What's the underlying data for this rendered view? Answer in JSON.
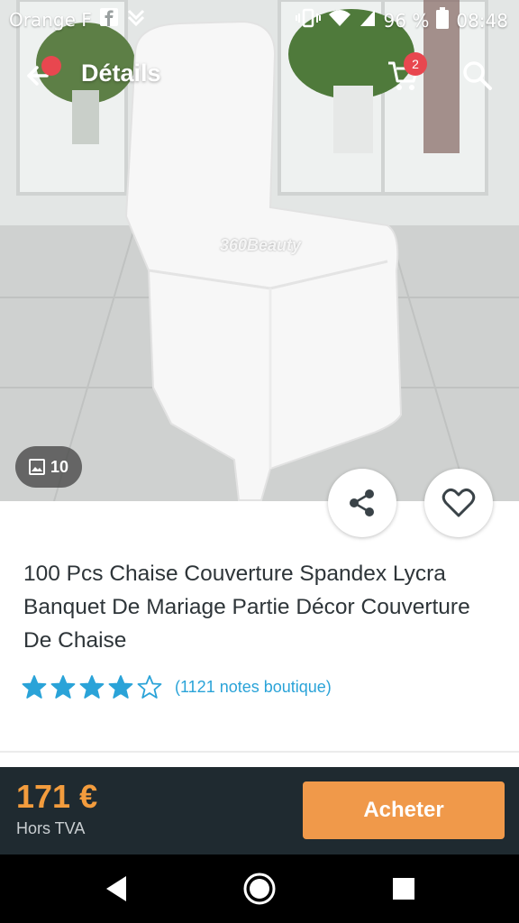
{
  "status_bar": {
    "carrier": "Orange F",
    "battery": "96 %",
    "time": "08:48",
    "icons": [
      "facebook-icon",
      "notification-icon",
      "vibrate-icon",
      "wifi-icon",
      "signal-icon",
      "battery-icon"
    ]
  },
  "app_bar": {
    "title": "Détails",
    "cart_count": "2"
  },
  "hero": {
    "watermark": "360Beauty",
    "image_count": "10"
  },
  "product": {
    "title": "100 Pcs Chaise Couverture Spandex Lycra Banquet De Mariage Partie Décor Couverture De Chaise",
    "rating_value": 4,
    "rating_max": 5,
    "rating_text": "(1121 notes boutique)"
  },
  "purchase": {
    "price": "171 €",
    "tax_note": "Hors TVA",
    "buy_label": "Acheter"
  },
  "colors": {
    "accent_orange": "#f0994a",
    "price_orange": "#f39c3d",
    "badge_red": "#e8474f",
    "star_blue": "#2aa3d8",
    "bar_dark": "#1f2a30"
  }
}
